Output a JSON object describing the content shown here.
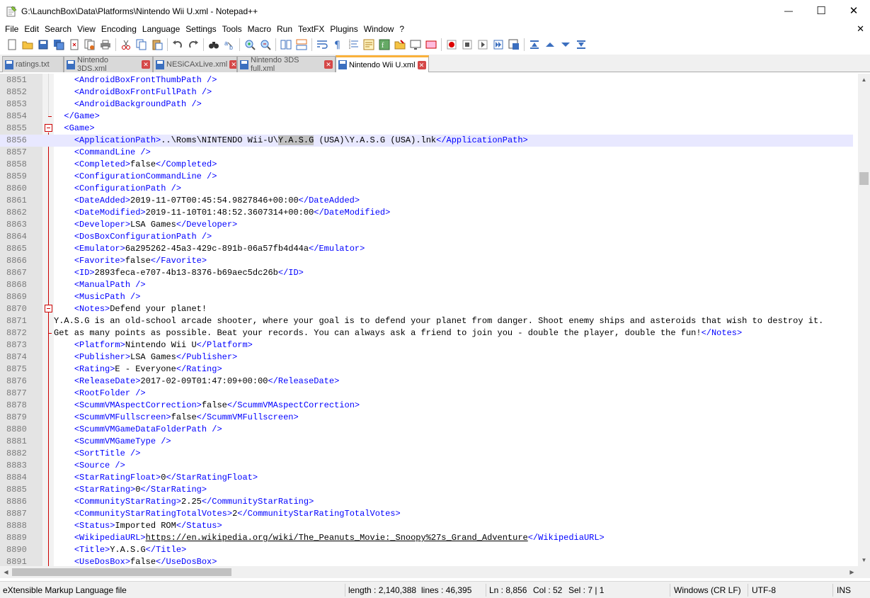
{
  "window": {
    "title": "G:\\LaunchBox\\Data\\Platforms\\Nintendo Wii U.xml - Notepad++",
    "minimize": "—",
    "maximize": "☐",
    "close": "✕"
  },
  "menu": {
    "items": [
      "File",
      "Edit",
      "Search",
      "View",
      "Encoding",
      "Language",
      "Settings",
      "Tools",
      "Macro",
      "Run",
      "TextFX",
      "Plugins",
      "Window",
      "?"
    ],
    "close_doc": "✕"
  },
  "tabs": [
    {
      "label": "ratings.txt",
      "active": false
    },
    {
      "label": "Nintendo 3DS.xml",
      "active": false
    },
    {
      "label": "NESiCAxLive.xml",
      "active": false
    },
    {
      "label": "Nintendo 3DS full.xml",
      "active": false
    },
    {
      "label": "Nintendo Wii U.xml",
      "active": true
    }
  ],
  "tab_close_glyph": "✕",
  "editor": {
    "lines": [
      {
        "n": "8851",
        "indent": "    ",
        "parts": [
          [
            "t",
            "<AndroidBoxFrontThumbPath />"
          ]
        ]
      },
      {
        "n": "8852",
        "indent": "    ",
        "parts": [
          [
            "t",
            "<AndroidBoxFrontFullPath />"
          ]
        ]
      },
      {
        "n": "8853",
        "indent": "    ",
        "parts": [
          [
            "t",
            "<AndroidBackgroundPath />"
          ]
        ]
      },
      {
        "n": "8854",
        "indent": "  ",
        "parts": [
          [
            "t",
            "</Game>"
          ]
        ]
      },
      {
        "n": "8855",
        "indent": "  ",
        "parts": [
          [
            "t",
            "<Game>"
          ]
        ]
      },
      {
        "n": "8856",
        "indent": "    ",
        "parts": [
          [
            "t",
            "<ApplicationPath>"
          ],
          [
            "x",
            "..\\Roms\\NINTENDO Wii-U\\"
          ],
          [
            "h",
            "Y.A.S.G"
          ],
          [
            "x",
            " (USA)\\Y.A.S.G (USA).lnk"
          ],
          [
            "t",
            "</ApplicationPath>"
          ]
        ]
      },
      {
        "n": "8857",
        "indent": "    ",
        "parts": [
          [
            "t",
            "<CommandLine />"
          ]
        ]
      },
      {
        "n": "8858",
        "indent": "    ",
        "parts": [
          [
            "t",
            "<Completed>"
          ],
          [
            "x",
            "false"
          ],
          [
            "t",
            "</Completed>"
          ]
        ]
      },
      {
        "n": "8859",
        "indent": "    ",
        "parts": [
          [
            "t",
            "<ConfigurationCommandLine />"
          ]
        ]
      },
      {
        "n": "8860",
        "indent": "    ",
        "parts": [
          [
            "t",
            "<ConfigurationPath />"
          ]
        ]
      },
      {
        "n": "8861",
        "indent": "    ",
        "parts": [
          [
            "t",
            "<DateAdded>"
          ],
          [
            "x",
            "2019-11-07T00:45:54.9827846+00:00"
          ],
          [
            "t",
            "</DateAdded>"
          ]
        ]
      },
      {
        "n": "8862",
        "indent": "    ",
        "parts": [
          [
            "t",
            "<DateModified>"
          ],
          [
            "x",
            "2019-11-10T01:48:52.3607314+00:00"
          ],
          [
            "t",
            "</DateModified>"
          ]
        ]
      },
      {
        "n": "8863",
        "indent": "    ",
        "parts": [
          [
            "t",
            "<Developer>"
          ],
          [
            "x",
            "LSA Games"
          ],
          [
            "t",
            "</Developer>"
          ]
        ]
      },
      {
        "n": "8864",
        "indent": "    ",
        "parts": [
          [
            "t",
            "<DosBoxConfigurationPath />"
          ]
        ]
      },
      {
        "n": "8865",
        "indent": "    ",
        "parts": [
          [
            "t",
            "<Emulator>"
          ],
          [
            "x",
            "6a295262-45a3-429c-891b-06a57fb4d44a"
          ],
          [
            "t",
            "</Emulator>"
          ]
        ]
      },
      {
        "n": "8866",
        "indent": "    ",
        "parts": [
          [
            "t",
            "<Favorite>"
          ],
          [
            "x",
            "false"
          ],
          [
            "t",
            "</Favorite>"
          ]
        ]
      },
      {
        "n": "8867",
        "indent": "    ",
        "parts": [
          [
            "t",
            "<ID>"
          ],
          [
            "x",
            "2893feca-e707-4b13-8376-b69aec5dc26b"
          ],
          [
            "t",
            "</ID>"
          ]
        ]
      },
      {
        "n": "8868",
        "indent": "    ",
        "parts": [
          [
            "t",
            "<ManualPath />"
          ]
        ]
      },
      {
        "n": "8869",
        "indent": "    ",
        "parts": [
          [
            "t",
            "<MusicPath />"
          ]
        ]
      },
      {
        "n": "8870",
        "indent": "    ",
        "parts": [
          [
            "t",
            "<Notes>"
          ],
          [
            "x",
            "Defend your planet!"
          ]
        ]
      },
      {
        "n": "8871",
        "indent": "",
        "parts": [
          [
            "x",
            "Y.A.S.G is an old-school arcade shooter, where your goal is to defend your planet from danger. Shoot enemy ships and asteroids that wish to destroy it."
          ]
        ]
      },
      {
        "n": "8872",
        "indent": "",
        "parts": [
          [
            "x",
            "Get as many points as possible. Beat your records. You can always ask a friend to join you - double the player, double the fun!"
          ],
          [
            "t",
            "</Notes>"
          ]
        ]
      },
      {
        "n": "8873",
        "indent": "    ",
        "parts": [
          [
            "t",
            "<Platform>"
          ],
          [
            "x",
            "Nintendo Wii U"
          ],
          [
            "t",
            "</Platform>"
          ]
        ]
      },
      {
        "n": "8874",
        "indent": "    ",
        "parts": [
          [
            "t",
            "<Publisher>"
          ],
          [
            "x",
            "LSA Games"
          ],
          [
            "t",
            "</Publisher>"
          ]
        ]
      },
      {
        "n": "8875",
        "indent": "    ",
        "parts": [
          [
            "t",
            "<Rating>"
          ],
          [
            "x",
            "E - Everyone"
          ],
          [
            "t",
            "</Rating>"
          ]
        ]
      },
      {
        "n": "8876",
        "indent": "    ",
        "parts": [
          [
            "t",
            "<ReleaseDate>"
          ],
          [
            "x",
            "2017-02-09T01:47:09+00:00"
          ],
          [
            "t",
            "</ReleaseDate>"
          ]
        ]
      },
      {
        "n": "8877",
        "indent": "    ",
        "parts": [
          [
            "t",
            "<RootFolder />"
          ]
        ]
      },
      {
        "n": "8878",
        "indent": "    ",
        "parts": [
          [
            "t",
            "<ScummVMAspectCorrection>"
          ],
          [
            "x",
            "false"
          ],
          [
            "t",
            "</ScummVMAspectCorrection>"
          ]
        ]
      },
      {
        "n": "8879",
        "indent": "    ",
        "parts": [
          [
            "t",
            "<ScummVMFullscreen>"
          ],
          [
            "x",
            "false"
          ],
          [
            "t",
            "</ScummVMFullscreen>"
          ]
        ]
      },
      {
        "n": "8880",
        "indent": "    ",
        "parts": [
          [
            "t",
            "<ScummVMGameDataFolderPath />"
          ]
        ]
      },
      {
        "n": "8881",
        "indent": "    ",
        "parts": [
          [
            "t",
            "<ScummVMGameType />"
          ]
        ]
      },
      {
        "n": "8882",
        "indent": "    ",
        "parts": [
          [
            "t",
            "<SortTitle />"
          ]
        ]
      },
      {
        "n": "8883",
        "indent": "    ",
        "parts": [
          [
            "t",
            "<Source />"
          ]
        ]
      },
      {
        "n": "8884",
        "indent": "    ",
        "parts": [
          [
            "t",
            "<StarRatingFloat>"
          ],
          [
            "x",
            "0"
          ],
          [
            "t",
            "</StarRatingFloat>"
          ]
        ]
      },
      {
        "n": "8885",
        "indent": "    ",
        "parts": [
          [
            "t",
            "<StarRating>"
          ],
          [
            "x",
            "0"
          ],
          [
            "t",
            "</StarRating>"
          ]
        ]
      },
      {
        "n": "8886",
        "indent": "    ",
        "parts": [
          [
            "t",
            "<CommunityStarRating>"
          ],
          [
            "x",
            "2.25"
          ],
          [
            "t",
            "</CommunityStarRating>"
          ]
        ]
      },
      {
        "n": "8887",
        "indent": "    ",
        "parts": [
          [
            "t",
            "<CommunityStarRatingTotalVotes>"
          ],
          [
            "x",
            "2"
          ],
          [
            "t",
            "</CommunityStarRatingTotalVotes>"
          ]
        ]
      },
      {
        "n": "8888",
        "indent": "    ",
        "parts": [
          [
            "t",
            "<Status>"
          ],
          [
            "x",
            "Imported ROM"
          ],
          [
            "t",
            "</Status>"
          ]
        ]
      },
      {
        "n": "8889",
        "indent": "    ",
        "parts": [
          [
            "t",
            "<WikipediaURL>"
          ],
          [
            "u",
            "https://en.wikipedia.org/wiki/The_Peanuts_Movie:_Snoopy%27s_Grand_Adventure"
          ],
          [
            "t",
            "</WikipediaURL>"
          ]
        ]
      },
      {
        "n": "8890",
        "indent": "    ",
        "parts": [
          [
            "t",
            "<Title>"
          ],
          [
            "x",
            "Y.A.S.G"
          ],
          [
            "t",
            "</Title>"
          ]
        ]
      },
      {
        "n": "8891",
        "indent": "    ",
        "parts": [
          [
            "t",
            "<UseDosBox>"
          ],
          [
            "x",
            "false"
          ],
          [
            "t",
            "</UseDosBox>"
          ]
        ]
      }
    ],
    "current_line": "8856"
  },
  "status": {
    "filetype": "eXtensible Markup Language file",
    "length": "length : 2,140,388",
    "lines": "lines : 46,395",
    "ln": "Ln : 8,856",
    "col": "Col : 52",
    "sel": "Sel : 7 | 1",
    "eol": "Windows (CR LF)",
    "encoding": "UTF-8",
    "mode": "INS"
  },
  "colors": {
    "tag": "#0000ff",
    "text": "#000000",
    "current_line_bg": "#e8e8ff",
    "selection_bg": "#c0c0c0",
    "active_tab_accent": "#fab13b"
  }
}
